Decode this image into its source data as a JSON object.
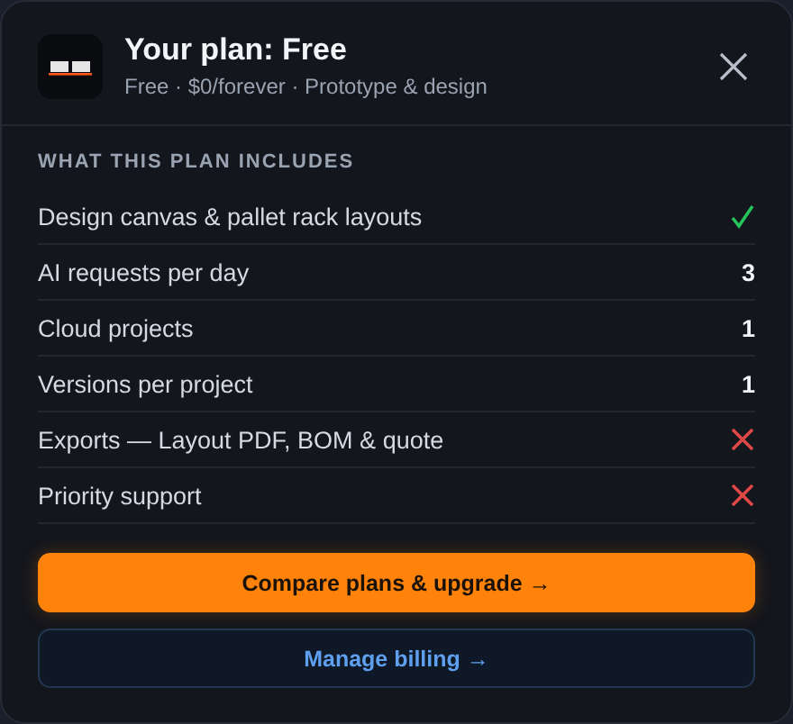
{
  "header": {
    "title": "Your plan: Free",
    "subtitle": "Free · $0/forever · Prototype & design"
  },
  "section_title": "WHAT THIS PLAN INCLUDES",
  "features": [
    {
      "label": "Design canvas & pallet rack layouts",
      "kind": "check"
    },
    {
      "label": "AI requests per day",
      "kind": "value",
      "value": "3"
    },
    {
      "label": "Cloud projects",
      "kind": "value",
      "value": "1"
    },
    {
      "label": "Versions per project",
      "kind": "value",
      "value": "1"
    },
    {
      "label": "Exports — Layout PDF, BOM & quote",
      "kind": "cross"
    },
    {
      "label": "Priority support",
      "kind": "cross"
    }
  ],
  "buttons": [
    {
      "label": "Compare plans & upgrade →",
      "kind": "primary"
    },
    {
      "label": "Manage billing →",
      "kind": "secondary"
    }
  ]
}
